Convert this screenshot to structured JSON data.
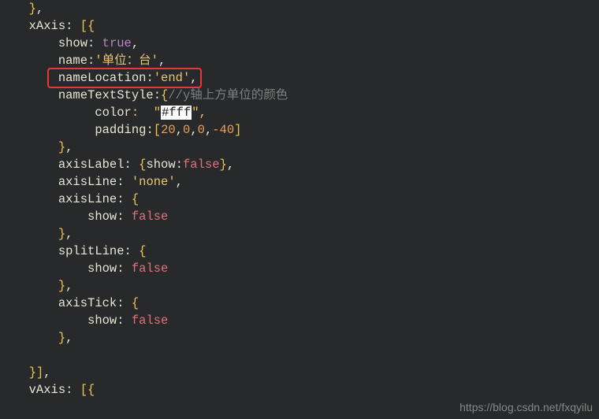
{
  "lines": {
    "l1a": "}",
    "l1b": ",",
    "l2a": "xAxis",
    "l2b": ": ",
    "l2c": "[{",
    "l3a": "show",
    "l3b": ": ",
    "l3c": "true",
    "l3d": ",",
    "l4a": "name",
    "l4b": ":",
    "l4c": "'单位：台'",
    "l4d": ",",
    "l5a": "nameLocation",
    "l5b": ":",
    "l5c": "'end'",
    "l5d": ",",
    "l6a": "nameTextStyle",
    "l6b": ":",
    "l6c": "{",
    "l6d": "//y轴上方单位的颜色",
    "l7a": "color",
    "l7b": ":  \"",
    "l7c": "#fff",
    "l7d": "\",",
    "l8a": "padding",
    "l8b": ":",
    "l8c": "[",
    "l8d": "20",
    "l8e": ",",
    "l8f": "0",
    "l8g": ",",
    "l8h": "0",
    "l8i": ",",
    "l8j": "-40",
    "l8k": "]",
    "l9a": "}",
    "l9b": ",",
    "l10a": "axisLabel",
    "l10b": ": ",
    "l10c": "{",
    "l10d": "show",
    "l10e": ":",
    "l10f": "false",
    "l10g": "}",
    "l10h": ",",
    "l11a": "axisLine",
    "l11b": ": ",
    "l11c": "'none'",
    "l11d": ",",
    "l12a": "axisLine",
    "l12b": ": ",
    "l12c": "{",
    "l13a": "show",
    "l13b": ": ",
    "l13c": "false",
    "l14a": "}",
    "l14b": ",",
    "l15a": "splitLine",
    "l15b": ": ",
    "l15c": "{",
    "l16a": "show",
    "l16b": ": ",
    "l16c": "false",
    "l17a": "}",
    "l17b": ",",
    "l18a": "axisTick",
    "l18b": ": ",
    "l18c": "{",
    "l19a": "show",
    "l19b": ": ",
    "l19c": "false",
    "l20a": "}",
    "l20b": ",",
    "l21a": "",
    "l22a": "}]",
    "l22b": ",",
    "l23a": "vAxis",
    "l23b": ": ",
    "l23c": "[{"
  },
  "watermark": "https://blog.csdn.net/fxqyilu"
}
